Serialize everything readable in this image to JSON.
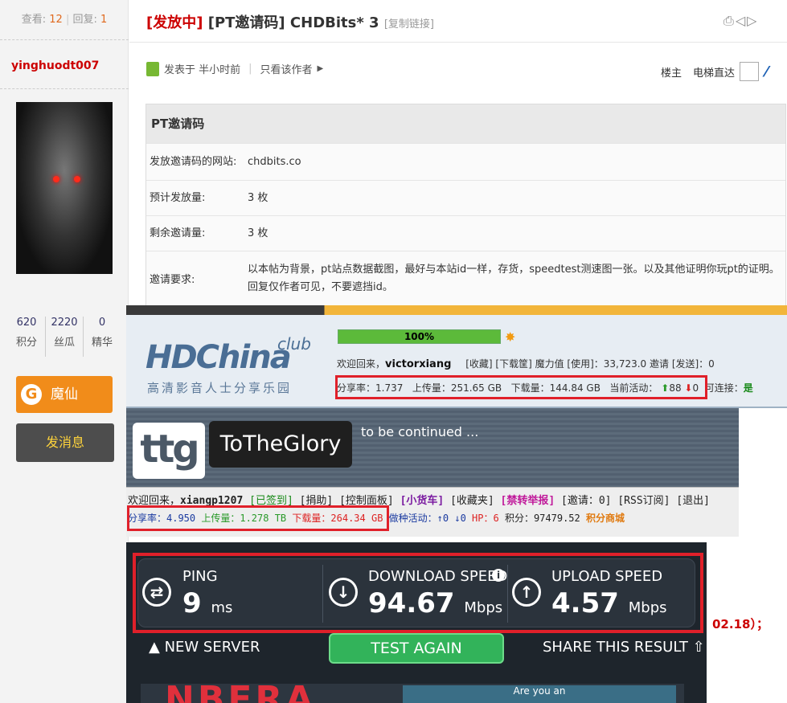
{
  "sidebar": {
    "views_label": "查看:",
    "views": "12",
    "replies_label": "回复:",
    "replies": "1",
    "username": "yinghuodt007",
    "stats": [
      {
        "num": "620",
        "label": "积分"
      },
      {
        "num": "2220",
        "label": "丝瓜"
      },
      {
        "num": "0",
        "label": "精华"
      }
    ],
    "magic_button": "魔仙",
    "message_button": "发消息"
  },
  "post": {
    "title_tag": "[发放中]",
    "title": "[PT邀请码] CHDBits* 3",
    "copy_link": "[复制链接]",
    "posted": "发表于 半小时前",
    "only_author": "只看该作者",
    "floor_owner": "楼主",
    "elevator": "电梯直达"
  },
  "invite_table": {
    "heading": "PT邀请码",
    "rows": [
      {
        "key": "发放邀请码的网站:",
        "value": "chdbits.co"
      },
      {
        "key": "预计发放量:",
        "value": "3 枚"
      },
      {
        "key": "剩余邀请量:",
        "value": "3 枚"
      },
      {
        "key": "邀请要求:",
        "value": "以本帖为背景，pt站点数据截图，最好与本站id一样，存货，speedtest测速图一张。以及其他证明你玩pt的证明。回复仅作者可见，不要遮挡id。"
      }
    ]
  },
  "hdchina": {
    "logo": "HDChina",
    "club": "club",
    "subtitle": "高清影音人士分享乐园",
    "progress": "100%",
    "welcome": "欢迎回来，",
    "user": "victorxiang",
    "links": "[收藏]  [下载筐]  魔力值 [使用]：33,723.0   邀请 [发送]：0",
    "ratio": "分享率：1.737",
    "uploaded": "上传量：251.65 GB",
    "downloaded": "下载量：144.84 GB",
    "activity": "当前活动：",
    "seeding": "88",
    "leeching": "0",
    "connectable": "可连接：",
    "connectable_val": "是"
  },
  "ttg": {
    "logo": "ttg",
    "name": "ToTheGlory",
    "tagline": "to be continued ...",
    "welcome": "欢迎回来，",
    "user": "xiangp1207",
    "signed": "[已签到]",
    "donate": "[捐助]",
    "panel": "[控制面板]",
    "truck": "[小货车]",
    "fav": "[收藏夹]",
    "report": "[禁转举报]",
    "invite": "[邀请：0]",
    "rss": "[RSS订阅]",
    "logout": "[退出]",
    "ratio": "分享率：4.950",
    "uploaded": "上传量：1.278 TB",
    "downloaded": "下载量：264.34 GB",
    "activity": "做种活动：↑0 ↓0",
    "hp": "HP：6",
    "points": "积分：97479.52",
    "mall": "积分商城"
  },
  "speedtest": {
    "ping_label": "PING",
    "ping_value": "9",
    "ping_unit": "ms",
    "download_label": "DOWNLOAD SPEED",
    "download_value": "94.67",
    "download_unit": "Mbps",
    "upload_label": "UPLOAD SPEED",
    "upload_value": "4.57",
    "upload_unit": "Mbps",
    "new_server": "NEW SERVER",
    "test_again": "TEST AGAIN",
    "share": "SHARE THIS RESULT",
    "ad_text": "NBERA",
    "ad_box": "Are you an"
  },
  "side_date": "02.18）；"
}
